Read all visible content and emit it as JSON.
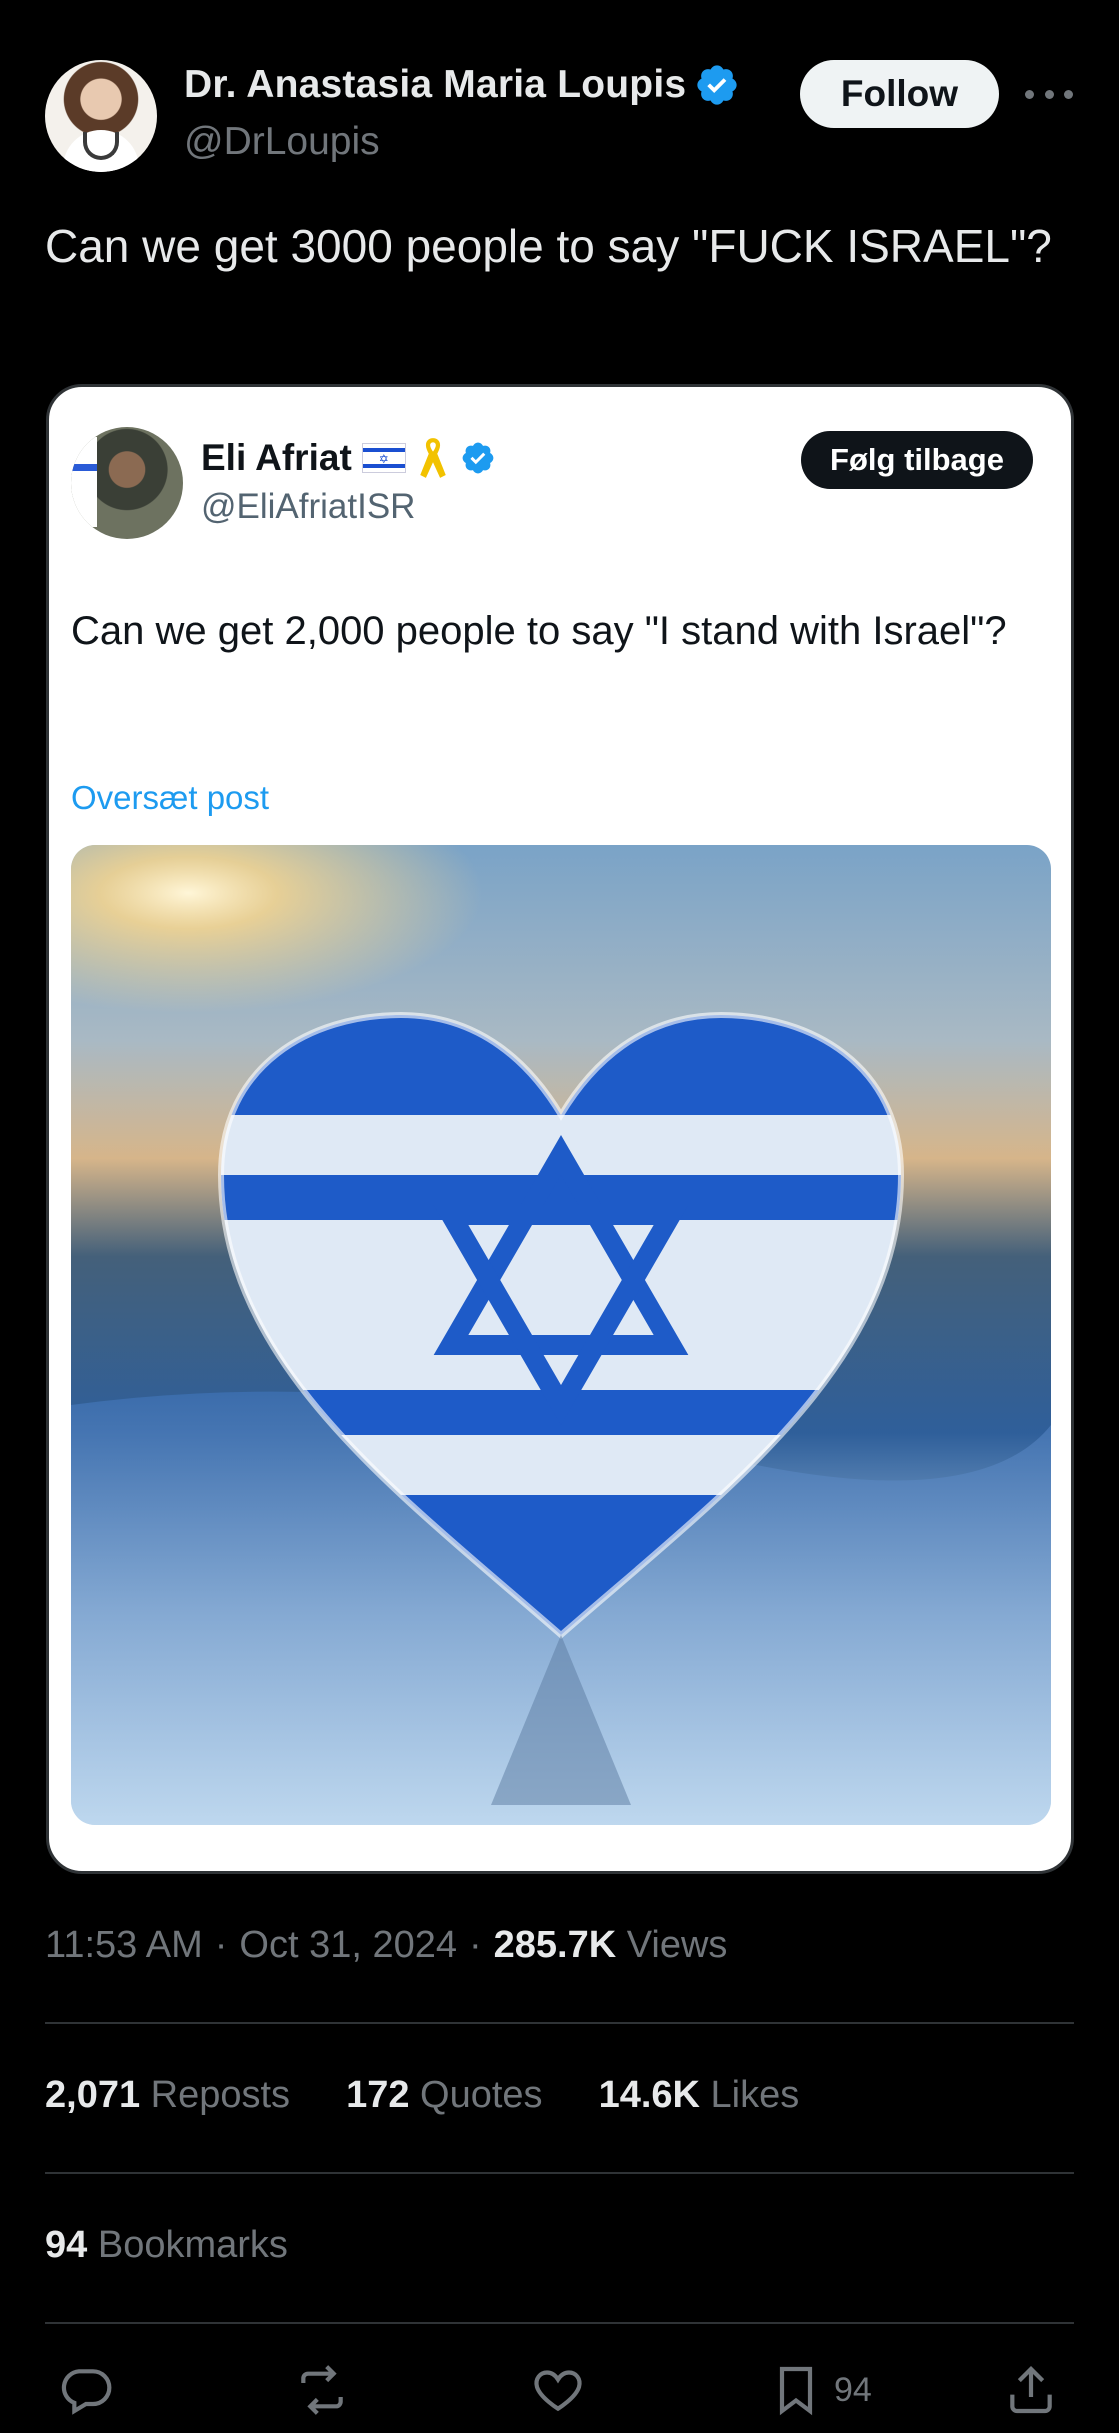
{
  "author": {
    "name": "Dr. Anastasia Maria Loupis",
    "handle": "@DrLoupis",
    "follow_label": "Follow"
  },
  "tweet": {
    "text": "Can we get 3000 people to say \"FUCK ISRAEL\"?"
  },
  "quoted": {
    "name": "Eli Afriat",
    "handle": "@EliAfriatISR",
    "follow_label": "Følg tilbage",
    "text": "Can we get 2,000 people to say \"I stand with Israel\"?",
    "translate_label": "Oversæt post",
    "image_icon": "israeli-flag-heart-image"
  },
  "meta": {
    "time": "11:53 AM",
    "separator": "·",
    "date": "Oct 31, 2024",
    "views_count": "285.7K",
    "views_label": "Views"
  },
  "stats": {
    "reposts_count": "2,071",
    "reposts_label": "Reposts",
    "quotes_count": "172",
    "quotes_label": "Quotes",
    "likes_count": "14.6K",
    "likes_label": "Likes",
    "bookmarks_count": "94",
    "bookmarks_label": "Bookmarks"
  },
  "actions": {
    "bookmark_count": "94"
  },
  "colors": {
    "background": "#000000",
    "accent": "#1d9bf0",
    "muted": "#71767b",
    "text": "#e7e9ea"
  }
}
